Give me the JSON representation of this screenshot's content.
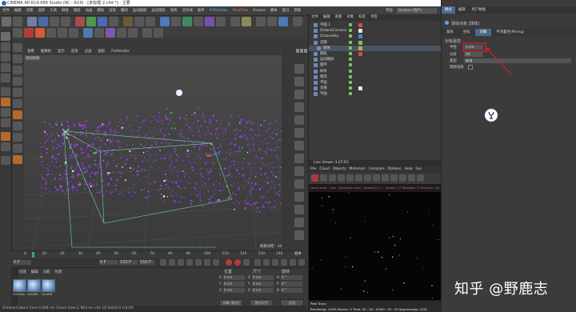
{
  "window": {
    "title": "CINEMA 4D R19.068 Studio (RC - R19) - [未标题 2.c4d *] - 主要",
    "controls": [
      "—",
      "□",
      "✕"
    ]
  },
  "menu": {
    "items": [
      "文件",
      "编辑",
      "创建",
      "选择",
      "工具",
      "网格",
      "捕捉",
      "动画",
      "模拟",
      "渲染",
      "雕刻",
      "运动跟踪",
      "运动图形",
      "角色",
      "流水线",
      "插件",
      "X-Particles",
      "RealFlow",
      "Octane",
      "脚本",
      "窗口",
      "帮助"
    ],
    "layout_label": "界面",
    "layout_value": "Octane (用户)"
  },
  "viewport": {
    "menu": [
      "查看",
      "摄像机",
      "显示",
      "选项",
      "过滤",
      "面板",
      "ProRender"
    ],
    "label": "透视视图",
    "distance": "网格间距 : 1000 cm"
  },
  "timeline": {
    "ticks": [
      "0",
      "10",
      "20",
      "30",
      "40",
      "50",
      "60",
      "70",
      "80",
      "90",
      "100",
      "110",
      "120",
      "130",
      "140",
      "150"
    ],
    "start": "0 F",
    "current": "0 F",
    "end": "150 F",
    "end2": "150 F",
    "frame_label": "0 F"
  },
  "material_manager": {
    "menu": [
      "创建",
      "编辑",
      "功能",
      "纹理"
    ],
    "materials": [
      "OctGlos",
      "OctDiff",
      "OctDiff"
    ]
  },
  "coordinates": {
    "headers": [
      "位置",
      "尺寸",
      "旋转"
    ],
    "rows": [
      {
        "axis": "X",
        "pos": "0 cm",
        "size": "0 cm",
        "rot_axis": "H",
        "rot": "0 °"
      },
      {
        "axis": "Y",
        "pos": "0 cm",
        "size": "0 cm",
        "rot_axis": "P",
        "rot": "0 °"
      },
      {
        "axis": "Z",
        "pos": "0 cm",
        "size": "0 cm",
        "rot_axis": "B",
        "rot": "0 °"
      }
    ],
    "mode": "对象 (相对)",
    "size_mode": "绝对尺寸",
    "apply": "应用"
  },
  "status": {
    "text": "Octane:Collect time:0.008 ms   Check time:1.963 ms   chk 10 fuid:0.0  cnt:50"
  },
  "object_manager": {
    "menu": [
      "文件",
      "编辑",
      "查看",
      "对象",
      "标签",
      "书签"
    ],
    "objects": [
      {
        "name": "平面.1"
      },
      {
        "name": "OctaneCamera"
      },
      {
        "name": "OctaneSky"
      },
      {
        "name": "克隆"
      },
      {
        "name": "球体"
      },
      {
        "name": "随机"
      },
      {
        "name": "运动图形"
      },
      {
        "name": "圆环"
      },
      {
        "name": "样条"
      },
      {
        "name": "矩阵"
      },
      {
        "name": "平面"
      },
      {
        "name": "克隆"
      },
      {
        "name": "平面"
      }
    ]
  },
  "live_viewer": {
    "title": "Live Viewer 3.07-R2",
    "menu": [
      "File",
      "Cloud",
      "Objects",
      "Materials",
      "Compare",
      "Options",
      "Help",
      "Gui"
    ],
    "info": "Check time : 1ms , MeshGen:0ms , Update[C]: 1 , Nodes: 17  Movable: 0  Textures: 0/0 ,  GPU Mem : 0 / 2.0G",
    "status_line1": "Path Trace",
    "status_line2": "Rendering: 100%   Ms/sec: 0   Time: 00 : 00 : 00/00 : 00 : 00   Spp/maxspp: 0/16"
  },
  "attributes": {
    "menu": [
      "模式",
      "编辑",
      "用户数据"
    ],
    "object_title": "球体对象 [球体]",
    "tabs": [
      "基本",
      "坐标",
      "对象",
      "平滑着色(Phong)"
    ],
    "active_tab": "对象",
    "section": "对象属性",
    "props": [
      {
        "label": "半径",
        "value": "1 cm"
      },
      {
        "label": "分段",
        "value": "24"
      },
      {
        "label": "类型",
        "value": "标准"
      },
      {
        "label": "理想渲染",
        "value": ""
      }
    ]
  },
  "watermark": "知乎 @野鹿志",
  "colors": {
    "accent_orange": "#e87a3f",
    "selection_blue": "#4d6a8d",
    "annotation_red": "#d82020",
    "particles": "#9d3cff"
  },
  "icons": {
    "object_icons": [
      "plane-icon",
      "camera-icon",
      "sky-icon",
      "cloner-icon",
      "sphere-icon",
      "random-icon",
      "mograph-icon",
      "torus-icon",
      "spline-icon",
      "matrix-icon",
      "plane-icon",
      "cloner-icon",
      "plane-icon"
    ]
  }
}
